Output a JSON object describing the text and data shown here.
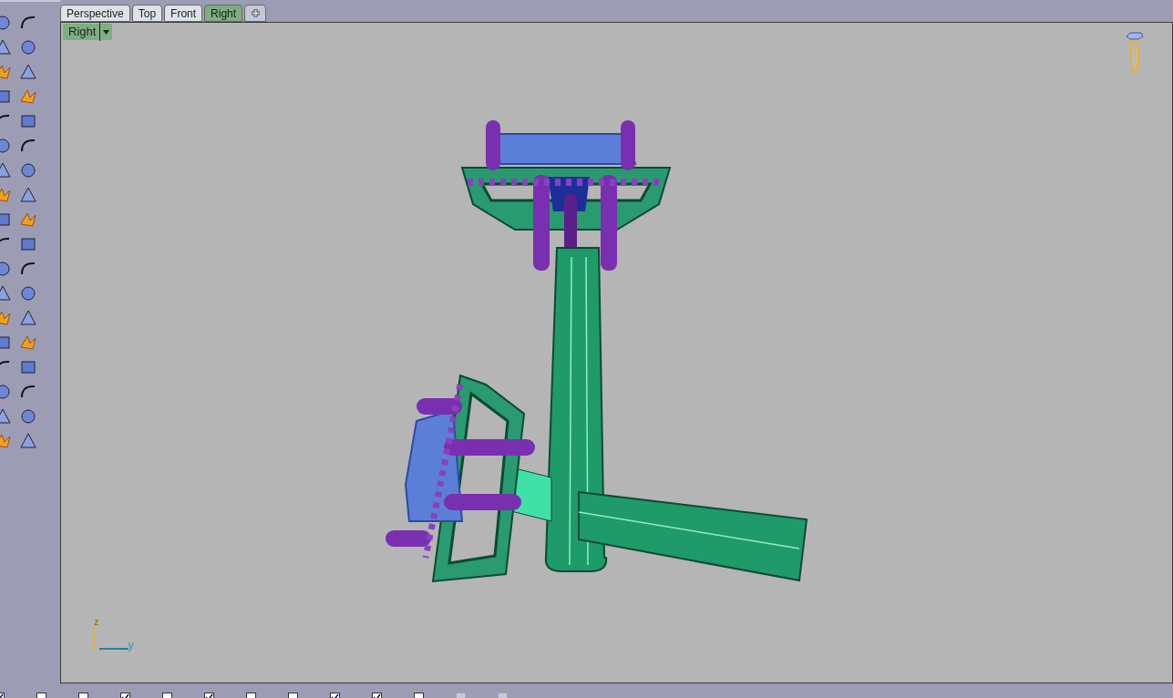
{
  "tabs": [
    {
      "label": "Perspective",
      "selected": false
    },
    {
      "label": "Top",
      "selected": false
    },
    {
      "label": "Front",
      "selected": false
    },
    {
      "label": "Right",
      "selected": true
    }
  ],
  "viewport": {
    "title": "Right",
    "axes": {
      "vertical": "z",
      "horizontal": "y"
    }
  },
  "osnaps": [
    {
      "checked": true,
      "disabled": false
    },
    {
      "checked": false,
      "disabled": false
    },
    {
      "checked": false,
      "disabled": false
    },
    {
      "checked": true,
      "disabled": false
    },
    {
      "checked": false,
      "disabled": false
    },
    {
      "checked": true,
      "disabled": false
    },
    {
      "checked": false,
      "disabled": false
    },
    {
      "checked": false,
      "disabled": false
    },
    {
      "checked": true,
      "disabled": false
    },
    {
      "checked": true,
      "disabled": false
    },
    {
      "checked": false,
      "disabled": false
    },
    {
      "checked": false,
      "disabled": true
    },
    {
      "checked": false,
      "disabled": true
    }
  ]
}
